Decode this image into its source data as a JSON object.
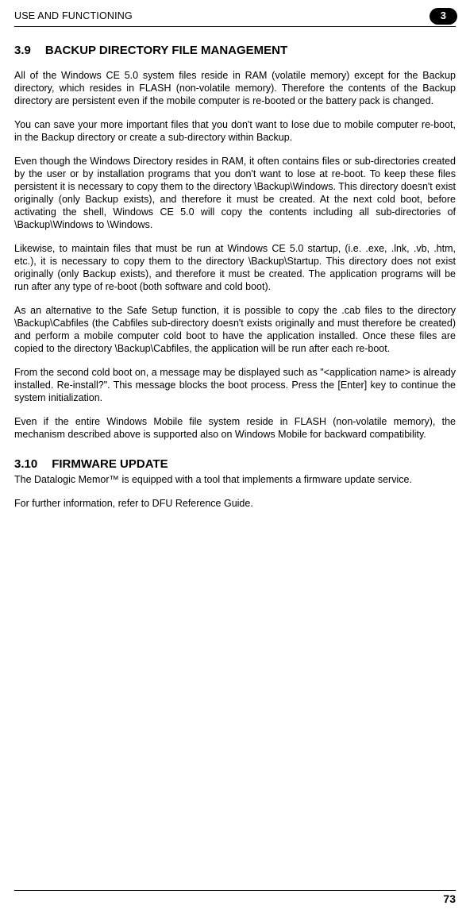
{
  "header": {
    "title": "USE AND FUNCTIONING",
    "page_badge": "3"
  },
  "section39": {
    "num": "3.9",
    "title": "BACKUP DIRECTORY FILE MANAGEMENT",
    "p1": "All of the Windows CE 5.0 system files reside in RAM (volatile memory) except for the Backup directory, which resides in FLASH (non-volatile memory). Therefore the contents of the Backup directory are persistent even if the mobile computer is re-booted or the battery pack is changed.",
    "p2": "You can save your more important files that you don't want to lose due to mobile computer re-boot, in the Backup directory or create a sub-directory within Backup.",
    "p3": "Even though the Windows Directory resides in RAM, it often contains files or sub-directories created by the user or by installation programs that you don't want to lose at re-boot. To keep these files persistent it is necessary to copy them to the directory \\Backup\\Windows. This directory doesn't exist originally (only Backup exists), and therefore it must be created. At the next cold boot, before activating the shell, Windows CE 5.0 will copy the contents including all sub-directories of \\Backup\\Windows to \\Windows.",
    "p4": "Likewise, to maintain files that must be run at Windows CE 5.0 startup, (i.e. .exe, .lnk, .vb, .htm, etc.), it is necessary to copy them to the directory \\Backup\\Startup. This directory does not exist originally (only Backup exists), and therefore it must be created. The application programs will be run after any type of re-boot (both software and cold boot).",
    "p5": "As an alternative to the Safe Setup function, it is possible to copy the .cab files to the directory \\Backup\\Cabfiles (the Cabfiles sub-directory doesn't exists originally and must therefore be created) and perform a mobile computer cold boot to have the application installed. Once these files are copied to the directory \\Backup\\Cabfiles, the application will be run after each re-boot.",
    "p6": "From the second cold boot on, a message may be displayed such as \"<application name> is already installed. Re-install?\". This message blocks the boot process. Press the [Enter] key to continue the system initialization.",
    "p7": "Even if the entire Windows Mobile file system reside in FLASH (non-volatile memory), the mechanism described above is supported also on Windows Mobile  for backward compatibility."
  },
  "section310": {
    "num": "3.10",
    "title": "FIRMWARE UPDATE",
    "p1": "The Datalogic Memor™ is equipped with a tool that implements a firmware update service.",
    "p2": "For further information, refer to DFU Reference Guide."
  },
  "footer_page": "73"
}
